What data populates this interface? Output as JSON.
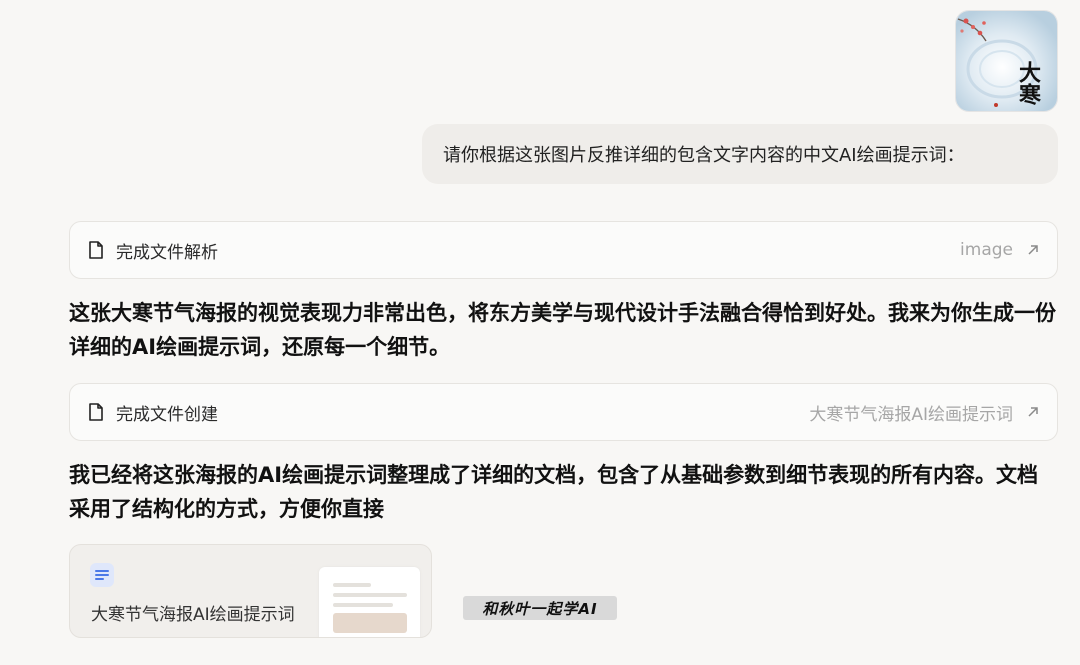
{
  "user": {
    "image_title_text": "大寒",
    "message": "请你根据这张图片反推详细的包含文字内容的中文AI绘画提示词："
  },
  "cards": {
    "parse": {
      "label": "完成文件解析",
      "link_text": "image",
      "icon": "document-icon",
      "link_icon": "external-arrow-icon"
    },
    "create": {
      "label": "完成文件创建",
      "link_text": "大寒节气海报AI绘画提示词",
      "icon": "document-icon",
      "link_icon": "external-arrow-icon"
    }
  },
  "assistant": {
    "paragraph_1": "这张大寒节气海报的视觉表现力非常出色，将东方美学与现代设计手法融合得恰到好处。我来为你生成一份详细的AI绘画提示词，还原每一个细节。",
    "paragraph_2": "我已经将这张海报的AI绘画提示词整理成了详细的文档，包含了从基础参数到细节表现的所有内容。文档采用了结构化的方式，方便你直接"
  },
  "document": {
    "title": "大寒节气海报AI绘画提示词",
    "icon": "doc-file-icon"
  },
  "watermark": "和秋叶一起学AI",
  "colors": {
    "background": "#f8f7f5",
    "bubble": "#efedea",
    "doc_accent": "#4a78e8",
    "muted_text": "#a6a6a6"
  }
}
